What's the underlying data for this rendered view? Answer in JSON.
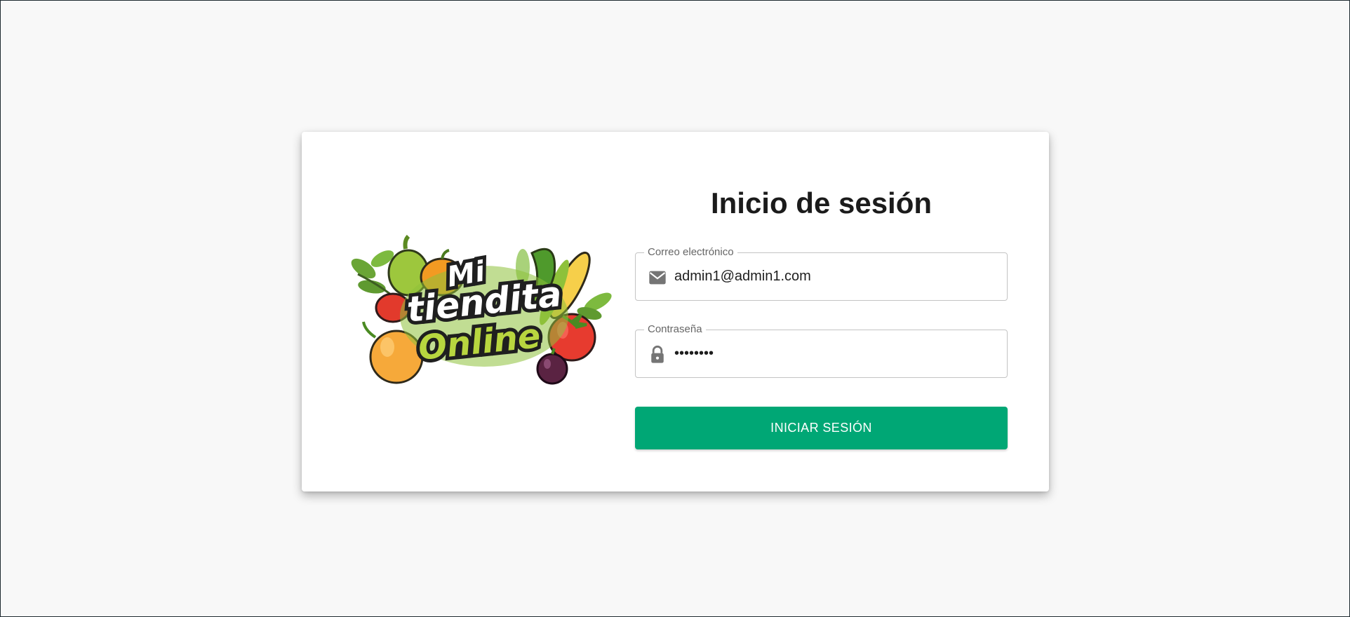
{
  "logo": {
    "line1": "Mi",
    "line2": "tiendita",
    "line3": "Online"
  },
  "login": {
    "title": "Inicio de sesión",
    "email": {
      "label": "Correo electrónico",
      "value": "admin1@admin1.com",
      "icon": "mail-icon"
    },
    "password": {
      "label": "Contraseña",
      "value": "••••••••",
      "icon": "lock-icon"
    },
    "submit_label": "INICIAR SESIÓN"
  },
  "colors": {
    "accent": "#00a775",
    "background": "#f8f8f8",
    "card": "#ffffff",
    "title": "#1b1b1b"
  }
}
